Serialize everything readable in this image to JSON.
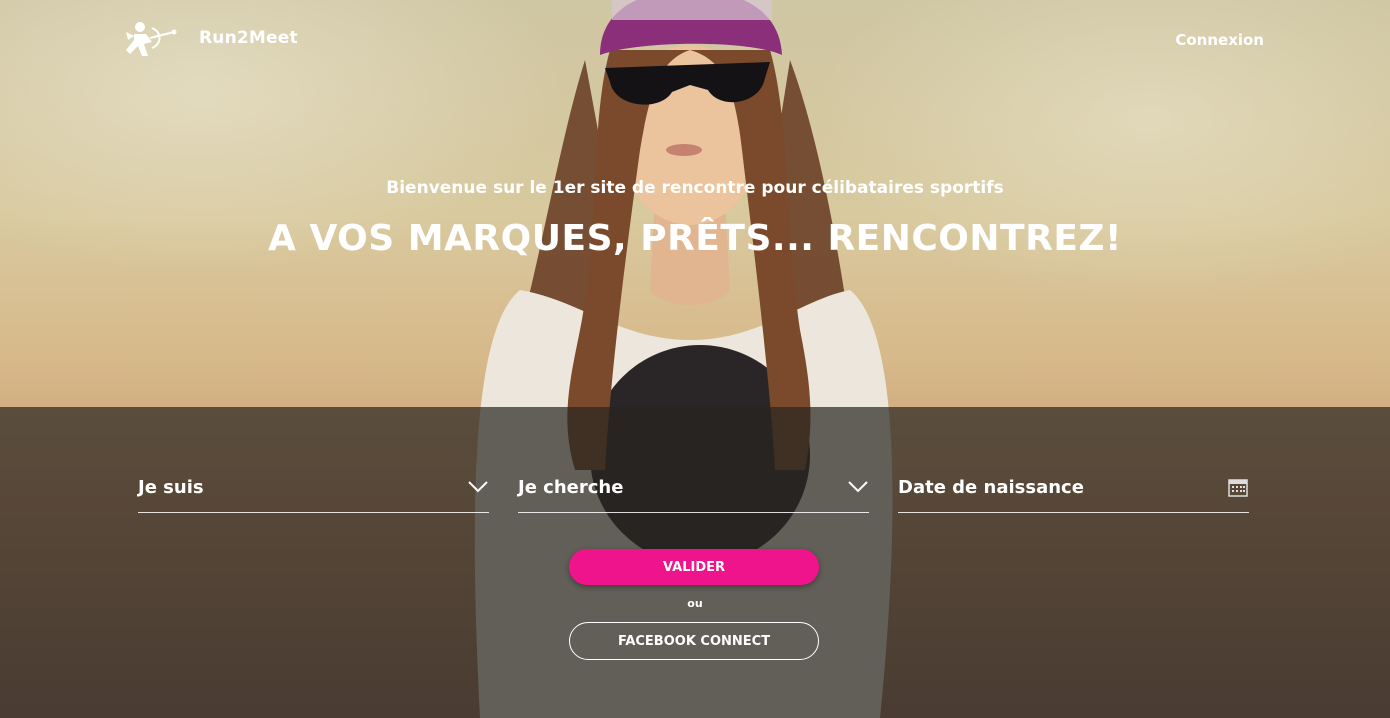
{
  "header": {
    "brand": "Run2Meet",
    "logo_icon": "cupid-runner-icon",
    "login_label": "Connexion"
  },
  "hero": {
    "subtitle": "Bienvenue sur le 1er site de rencontre pour célibataires sportifs",
    "title": "A VOS MARQUES, PRÊTS... RENCONTREZ!"
  },
  "form": {
    "gender_label": "Je suis",
    "seeking_label": "Je cherche",
    "birthdate_label": "Date de naissance",
    "chevron_icon": "chevron-down-icon",
    "calendar_icon": "calendar-icon",
    "submit_label": "VALIDER",
    "or_label": "ou",
    "facebook_label": "FACEBOOK CONNECT"
  },
  "colors": {
    "accent": "#f0148c",
    "overlay": "#28241f"
  }
}
